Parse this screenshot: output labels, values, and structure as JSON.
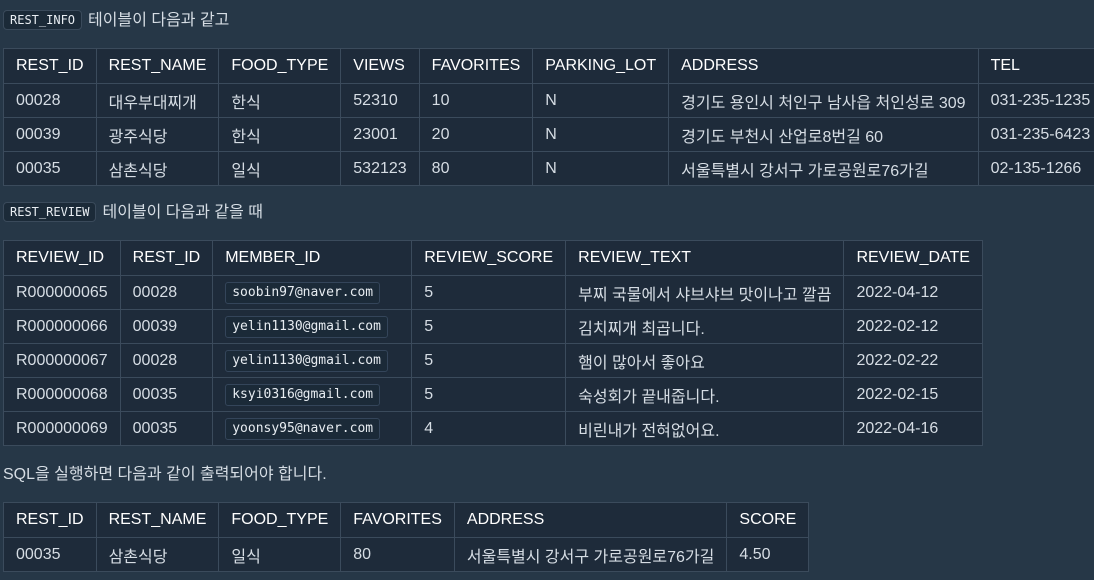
{
  "intro1": {
    "code": "REST_INFO",
    "text": "테이블이 다음과 같고"
  },
  "intro2": {
    "code": "REST_REVIEW",
    "text": "테이블이 다음과 같을 때"
  },
  "intro3": {
    "text": "SQL을 실행하면 다음과 같이 출력되어야 합니다."
  },
  "rest_info": {
    "headers": [
      "REST_ID",
      "REST_NAME",
      "FOOD_TYPE",
      "VIEWS",
      "FAVORITES",
      "PARKING_LOT",
      "ADDRESS",
      "TEL"
    ],
    "rows": [
      [
        "00028",
        "대우부대찌개",
        "한식",
        "52310",
        "10",
        "N",
        "경기도 용인시 처인구 남사읍 처인성로 309",
        "031-235-1235"
      ],
      [
        "00039",
        "광주식당",
        "한식",
        "23001",
        "20",
        "N",
        "경기도 부천시 산업로8번길 60",
        "031-235-6423"
      ],
      [
        "00035",
        "삼촌식당",
        "일식",
        "532123",
        "80",
        "N",
        "서울특별시 강서구 가로공원로76가길",
        "02-135-1266"
      ]
    ]
  },
  "rest_review": {
    "headers": [
      "REVIEW_ID",
      "REST_ID",
      "MEMBER_ID",
      "REVIEW_SCORE",
      "REVIEW_TEXT",
      "REVIEW_DATE"
    ],
    "rows": [
      [
        "R000000065",
        "00028",
        "soobin97@naver.com",
        "5",
        "부찌 국물에서 샤브샤브 맛이나고 깔끔",
        "2022-04-12"
      ],
      [
        "R000000066",
        "00039",
        "yelin1130@gmail.com",
        "5",
        "김치찌개 최곱니다.",
        "2022-02-12"
      ],
      [
        "R000000067",
        "00028",
        "yelin1130@gmail.com",
        "5",
        "햄이 많아서 좋아요",
        "2022-02-22"
      ],
      [
        "R000000068",
        "00035",
        "ksyi0316@gmail.com",
        "5",
        "숙성회가 끝내줍니다.",
        "2022-02-15"
      ],
      [
        "R000000069",
        "00035",
        "yoonsy95@naver.com",
        "4",
        "비린내가 전혀없어요.",
        "2022-04-16"
      ]
    ]
  },
  "result": {
    "headers": [
      "REST_ID",
      "REST_NAME",
      "FOOD_TYPE",
      "FAVORITES",
      "ADDRESS",
      "SCORE"
    ],
    "rows": [
      [
        "00035",
        "삼촌식당",
        "일식",
        "80",
        "서울특별시 강서구 가로공원로76가길",
        "4.50"
      ]
    ]
  }
}
